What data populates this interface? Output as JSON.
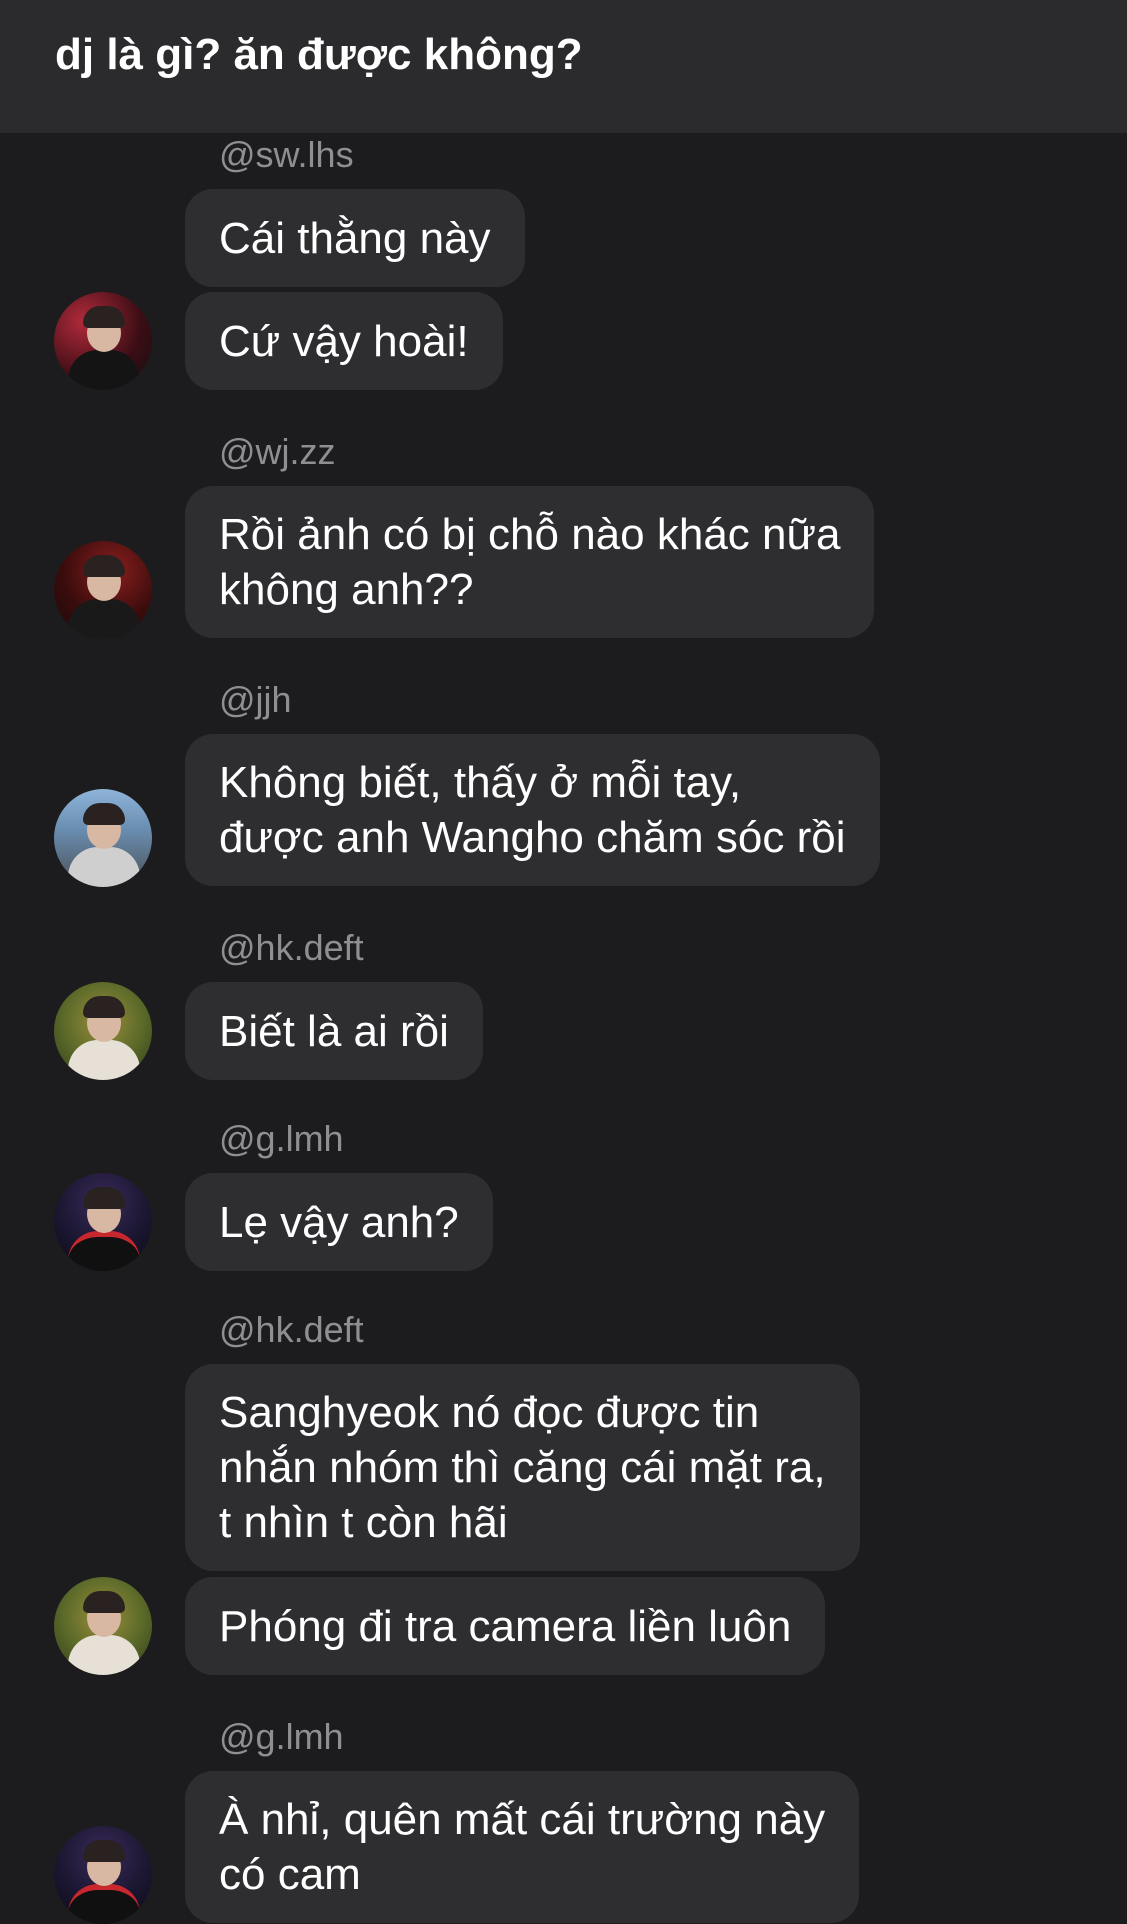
{
  "header": {
    "title": "dj là gì? ăn được không?"
  },
  "messages": [
    {
      "handle": "@sw.lhs",
      "bubbles": [
        "Cái thằng này",
        "Cứ vậy hoài!"
      ]
    },
    {
      "handle": "@wj.zz",
      "bubbles": [
        "Rồi ảnh có bị chỗ nào khác nữa\nkhông anh??"
      ]
    },
    {
      "handle": "@jjh",
      "bubbles": [
        "Không biết, thấy ở mỗi tay,\nđược anh Wangho chăm sóc rồi"
      ]
    },
    {
      "handle": "@hk.deft",
      "bubbles": [
        "Biết là ai rồi"
      ]
    },
    {
      "handle": "@g.lmh",
      "bubbles": [
        "Lẹ vậy anh?"
      ]
    },
    {
      "handle": "@hk.deft",
      "bubbles": [
        "Sanghyeok nó đọc được tin\nnhắn nhóm thì căng cái mặt ra,\nt nhìn t còn hãi",
        "Phóng đi tra camera liền luôn"
      ]
    },
    {
      "handle": "@g.lmh",
      "bubbles": [
        "À nhỉ, quên mất cái trường này\ncó cam"
      ]
    }
  ]
}
